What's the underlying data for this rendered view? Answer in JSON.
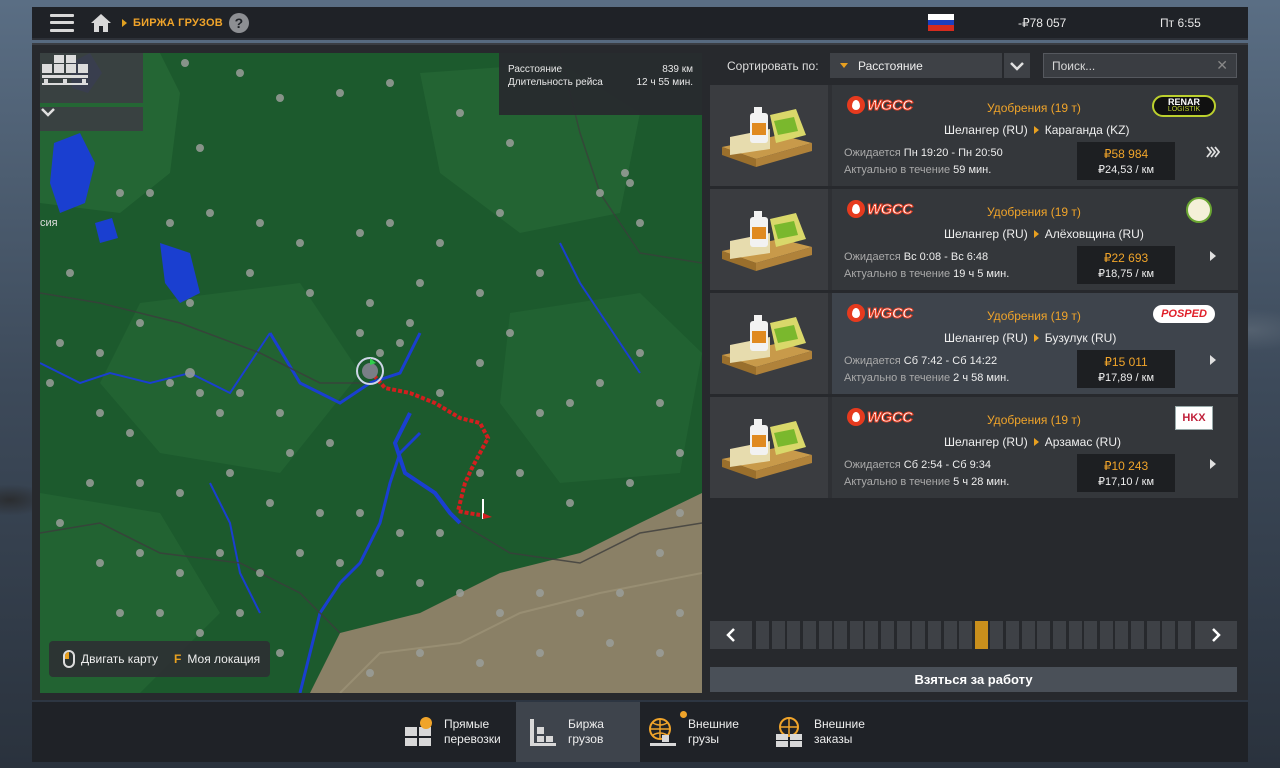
{
  "topbar": {
    "breadcrumb": "БИРЖА ГРУЗОВ",
    "help": "?",
    "money": "-₽78 057",
    "time": "Пт 6:55",
    "flag_colors": [
      "#ffffff",
      "#1c3fbf",
      "#d52b1e"
    ]
  },
  "map": {
    "route_info": {
      "distance_label": "Расстояние",
      "distance_value": "839 км",
      "duration_label": "Длительность рейса",
      "duration_value": "12 ч 55 мин."
    },
    "edge_label": "сия",
    "hints": {
      "move": "Двигать карту",
      "locate_key": "F",
      "locate": "Моя локация"
    }
  },
  "sort": {
    "label": "Сортировать по:",
    "value": "Расстояние",
    "search_placeholder": "Поиск..."
  },
  "jobs": [
    {
      "company": "WGCC",
      "cargo": "Удобрения (19 т)",
      "from": "Шелангер (RU)",
      "to": "Караганда (KZ)",
      "expected_label": "Ожидается",
      "expected": "Пн 19:20 - Пн 20:50",
      "valid_label": "Актуально в течение",
      "valid": "59 мин.",
      "price": "₽58 984",
      "per_km": "₽24,53 / км",
      "receiver_logo": "renar-logistik",
      "receiver_text": "RENAR",
      "receiver_sub": "LOGISTIK",
      "arrow": "double"
    },
    {
      "company": "WGCC",
      "cargo": "Удобрения (19 т)",
      "from": "Шелангер (RU)",
      "to": "Алёховщина (RU)",
      "expected_label": "Ожидается",
      "expected": "Вс 0:08 - Вс 6:48",
      "valid_label": "Актуально в течение",
      "valid": "19 ч 5 мин.",
      "price": "₽22 693",
      "per_km": "₽18,75 / км",
      "receiver_logo": "farm-logo",
      "arrow": "single"
    },
    {
      "company": "WGCC",
      "cargo": "Удобрения (19 т)",
      "from": "Шелангер (RU)",
      "to": "Бузулук (RU)",
      "expected_label": "Ожидается",
      "expected": "Сб 7:42 - Сб 14:22",
      "valid_label": "Актуально в течение",
      "valid": "2 ч 58 мин.",
      "price": "₽15 011",
      "per_km": "₽17,89 / км",
      "receiver_logo": "posped",
      "receiver_text": "POSPED",
      "arrow": "single"
    },
    {
      "company": "WGCC",
      "cargo": "Удобрения (19 т)",
      "from": "Шелангер (RU)",
      "to": "Арзамас (RU)",
      "expected_label": "Ожидается",
      "expected": "Сб 2:54 - Сб 9:34",
      "valid_label": "Актуально в течение",
      "valid": "5 ч 28 мин.",
      "price": "₽10 243",
      "per_km": "₽17,10 / км",
      "receiver_logo": "hkx",
      "receiver_text": "HKX",
      "arrow": "single"
    }
  ],
  "pager": {
    "total_pages": 28,
    "current_page": 15
  },
  "accept_button": "Взяться за работу",
  "tabs": [
    {
      "line1": "Прямые",
      "line2": "перевозки",
      "icon": "direct-transport-icon"
    },
    {
      "line1": "Биржа",
      "line2": "грузов",
      "icon": "freight-market-icon"
    },
    {
      "line1": "Внешние",
      "line2": "грузы",
      "icon": "external-cargo-icon"
    },
    {
      "line1": "Внешние",
      "line2": "заказы",
      "icon": "external-orders-icon"
    }
  ],
  "colors": {
    "accent": "#f0a42a",
    "route": "#d21f1f",
    "map_land": "#1c5a2d",
    "map_water": "#1a3fd0",
    "map_steppe": "#8a8066"
  }
}
